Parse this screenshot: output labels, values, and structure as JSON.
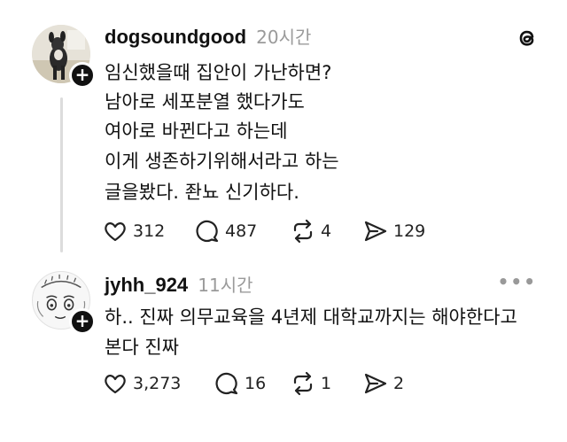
{
  "app": {
    "logo_icon": "threads-logo-icon"
  },
  "posts": [
    {
      "username": "dogsoundgood",
      "time": "20시간",
      "lines": [
        "임신했을때 집안이 가난하면?",
        "남아로 세포분열 했다가도",
        "여아로 바뀐다고 하는데",
        "이게 생존하기위해서라고 하는",
        "글을봤다. 좐뇨 신기하다."
      ],
      "likes": "312",
      "comments": "487",
      "reposts": "4",
      "shares": "129"
    },
    {
      "username": "jyhh_924",
      "time": "11시간",
      "more": "•••",
      "lines": [
        "하.. 진짜 의무교육을 4년제 대학교까지는 해야한다고",
        "본다 진짜"
      ],
      "likes": "3,273",
      "comments": "16",
      "reposts": "1",
      "shares": "2"
    }
  ],
  "colors": {
    "text": "#111111",
    "muted": "#9a9a9a",
    "line": "#dcdcdc"
  }
}
